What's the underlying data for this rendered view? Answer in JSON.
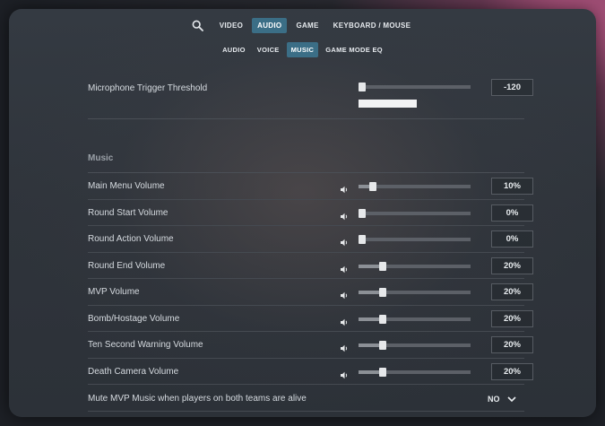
{
  "nav": {
    "tabs": [
      {
        "label": "VIDEO"
      },
      {
        "label": "AUDIO"
      },
      {
        "label": "GAME"
      },
      {
        "label": "KEYBOARD / MOUSE"
      }
    ],
    "active_tab": "AUDIO"
  },
  "subnav": {
    "tabs": [
      {
        "label": "AUDIO"
      },
      {
        "label": "VOICE"
      },
      {
        "label": "MUSIC"
      },
      {
        "label": "GAME MODE EQ"
      }
    ],
    "active_tab": "MUSIC"
  },
  "threshold": {
    "label": "Microphone Trigger Threshold",
    "value": "-120",
    "slider_fraction": 0.0,
    "mic_level_fraction": 0.52
  },
  "music": {
    "section_title": "Music",
    "rows": [
      {
        "label": "Main Menu Volume",
        "value": "10%",
        "fraction": 0.1
      },
      {
        "label": "Round Start Volume",
        "value": "0%",
        "fraction": 0.0
      },
      {
        "label": "Round Action Volume",
        "value": "0%",
        "fraction": 0.0
      },
      {
        "label": "Round End Volume",
        "value": "20%",
        "fraction": 0.2
      },
      {
        "label": "MVP Volume",
        "value": "20%",
        "fraction": 0.2
      },
      {
        "label": "Bomb/Hostage Volume",
        "value": "20%",
        "fraction": 0.2
      },
      {
        "label": "Ten Second Warning Volume",
        "value": "20%",
        "fraction": 0.2
      },
      {
        "label": "Death Camera Volume",
        "value": "20%",
        "fraction": 0.2
      }
    ],
    "mute_mvp": {
      "label": "Mute MVP Music when players on both teams are alive",
      "value": "NO"
    }
  },
  "icons": {
    "search": "search-icon",
    "speaker": "speaker-icon",
    "chevron": "chevron-down-icon"
  },
  "colors": {
    "active_tab_bg": "#3b6e86",
    "slider_track": "#5c6067",
    "slider_thumb": "#e6e8ea"
  }
}
